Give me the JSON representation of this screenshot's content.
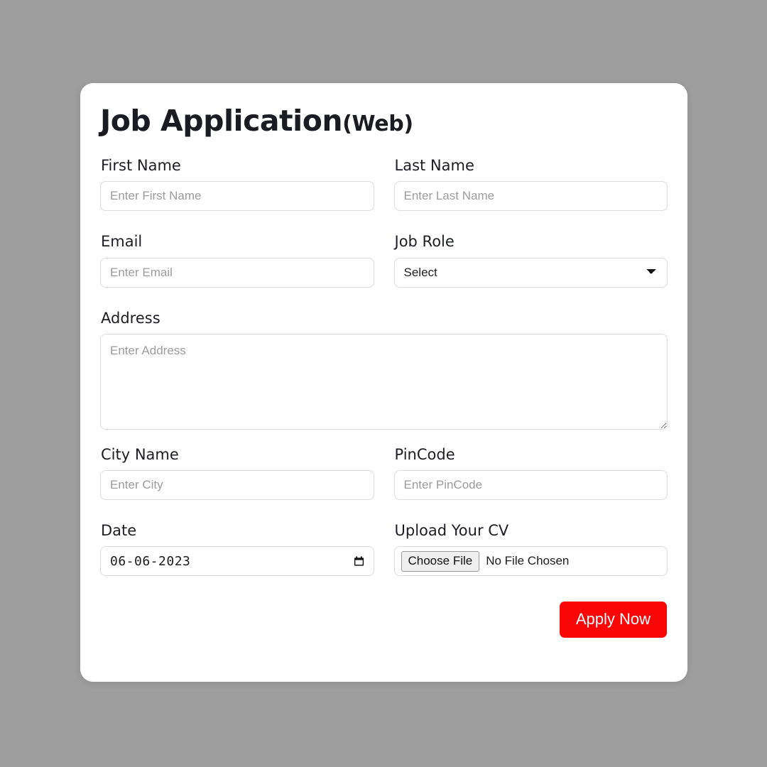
{
  "page": {
    "background_color": "#9e9e9e",
    "card_background": "#ffffff"
  },
  "form": {
    "title_main": "Job Application",
    "title_suffix": "(Web)",
    "fields": {
      "first_name": {
        "label": "First Name",
        "placeholder": "Enter First Name",
        "value": ""
      },
      "last_name": {
        "label": "Last Name",
        "placeholder": "Enter Last Name",
        "value": ""
      },
      "email": {
        "label": "Email",
        "placeholder": "Enter Email",
        "value": ""
      },
      "job_role": {
        "label": "Job Role",
        "selected": "Select"
      },
      "address": {
        "label": "Address",
        "placeholder": "Enter Address",
        "value": ""
      },
      "city": {
        "label": "City Name",
        "placeholder": "Enter City",
        "value": ""
      },
      "pincode": {
        "label": "PinCode",
        "placeholder": "Enter PinCode",
        "value": ""
      },
      "date": {
        "label": "Date",
        "value": "06-06-2023"
      },
      "cv_upload": {
        "label": "Upload Your CV",
        "button_label": "Choose File",
        "status": "No File Chosen"
      }
    },
    "submit": {
      "label": "Apply Now",
      "color": "#fb0606",
      "text_color": "#ffffff"
    }
  },
  "icons": {
    "chevron_down": "chevron-down-icon",
    "calendar": "calendar-icon",
    "resize_handle": "resize-handle-icon"
  }
}
